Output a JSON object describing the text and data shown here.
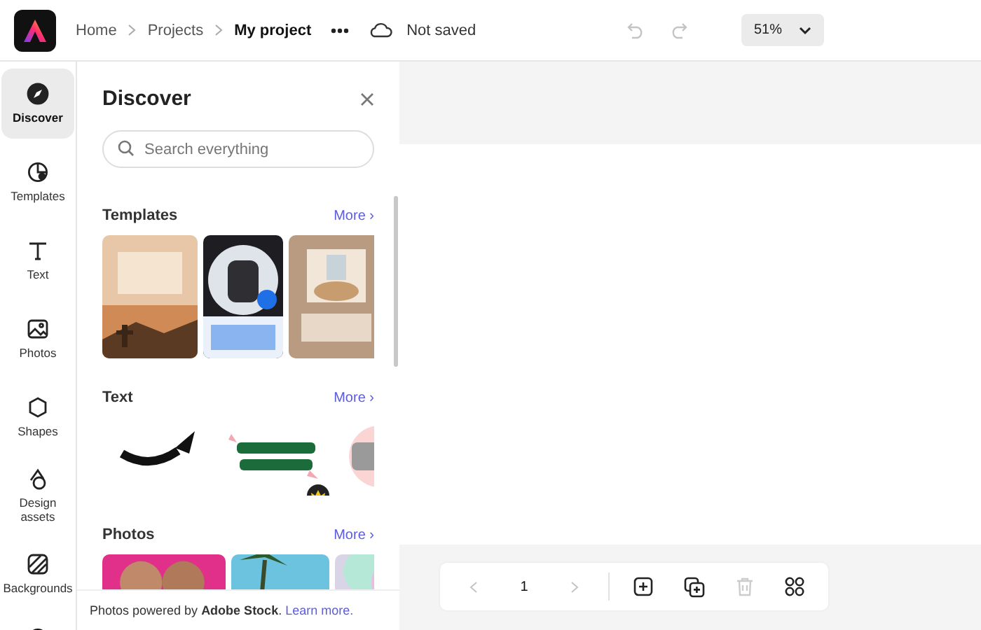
{
  "app_bar": {
    "breadcrumbs": [
      {
        "label": "Home",
        "current": false
      },
      {
        "label": "Projects",
        "current": false
      },
      {
        "label": "My project",
        "current": true
      }
    ],
    "save_status": "Not saved",
    "undo": {
      "disabled": true
    },
    "redo": {
      "disabled": true
    },
    "zoom": "51%"
  },
  "rail": [
    {
      "kind": "discover",
      "label": "Discover",
      "selected": true
    },
    {
      "kind": "templates",
      "label": "Templates",
      "selected": false
    },
    {
      "kind": "text",
      "label": "Text",
      "selected": false
    },
    {
      "kind": "photos",
      "label": "Photos",
      "selected": false
    },
    {
      "kind": "shapes",
      "label": "Shapes",
      "selected": false
    },
    {
      "kind": "assets",
      "label": "Design assets",
      "selected": false
    },
    {
      "kind": "backgrounds",
      "label": "Backgrounds",
      "selected": false
    },
    {
      "kind": "more"
    }
  ],
  "panel": {
    "title": "Discover",
    "search": {
      "placeholder": "Search everything"
    },
    "sections": [
      {
        "title": "Templates",
        "more": "More ›",
        "kind": "templates",
        "thumbs": [
          {
            "kind": "picture",
            "premium": false
          },
          {
            "kind": "picture",
            "premium": false
          },
          {
            "kind": "picture",
            "premium": false
          }
        ]
      },
      {
        "title": "Text",
        "more": "More ›",
        "kind": "text",
        "thumbs": [
          {
            "kind": "picture",
            "premium": false
          },
          {
            "kind": "picture",
            "premium": true
          },
          {
            "kind": "picture"
          }
        ]
      },
      {
        "title": "Photos",
        "more": "More ›",
        "kind": "photos",
        "thumbs": [
          {
            "kind": "picture"
          },
          {
            "kind": "picture"
          },
          {
            "kind": "picture"
          }
        ]
      }
    ],
    "footer": {
      "text": "Photos powered by **Adobe Stock**.",
      "link": "Learn more."
    }
  },
  "page_toolbar": {
    "prev": {
      "disabled": true
    },
    "page_number": "1",
    "next": {
      "disabled": true
    },
    "actions": [
      {
        "kind": "add",
        "disabled": false
      },
      {
        "kind": "duplicate",
        "disabled": false
      },
      {
        "kind": "delete",
        "disabled": true
      },
      {
        "kind": "grid",
        "disabled": false
      }
    ]
  }
}
